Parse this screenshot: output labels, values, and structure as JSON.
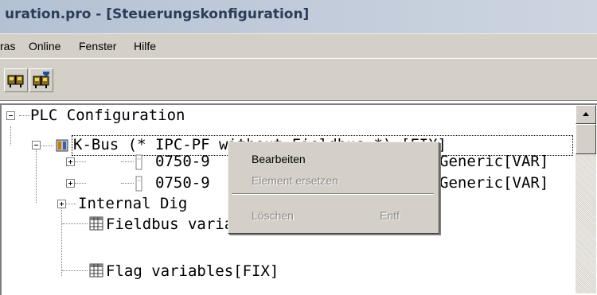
{
  "window": {
    "title": "uration.pro - [Steuerungskonfiguration]"
  },
  "menubar": {
    "items": [
      "ras",
      "Online",
      "Fenster",
      "Hilfe"
    ]
  },
  "toolbar": {
    "buttons": [
      "bus-scan-icon",
      "bus-scan-download-icon"
    ]
  },
  "tree": {
    "root": "PLC Configuration",
    "kbus": "K-Bus (* IPC-PF without Fieldbus *) [FIX]",
    "module1_left": "0750-9",
    "module1_right": "Generic[VAR]",
    "module2_left": "0750-9",
    "module2_right": "Generic[VAR]",
    "internal": "Internal Dig",
    "fieldbus_vars": "Fieldbus variables[FIX]",
    "flag_vars": "Flag variables[FIX]"
  },
  "context_menu": {
    "items": [
      {
        "label": "Bearbeiten",
        "enabled": true
      },
      {
        "label": "Element ersetzen",
        "enabled": false
      },
      {
        "label": "Löschen",
        "enabled": false,
        "shortcut": "Entf"
      }
    ]
  },
  "colors": {
    "title_text": "#2b3d57",
    "chrome": "#d4d0c8",
    "disabled_text": "#8c8a86"
  }
}
